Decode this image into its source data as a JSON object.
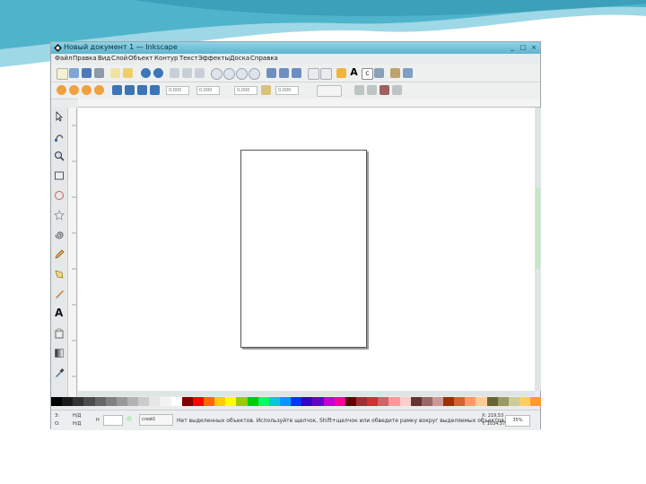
{
  "window": {
    "title": "Новый документ 1 — Inkscape"
  },
  "menubar": {
    "items": [
      "Файл",
      "Правка",
      "Вид",
      "Слой",
      "Объект",
      "Контур",
      "Текст",
      "Эффекты",
      "Доска",
      "Справка"
    ]
  },
  "toolcontrols": {
    "fields": [
      "0,000",
      "0,000",
      "0,000",
      "0,000"
    ]
  },
  "toolbox": {
    "tools": [
      "selector-icon",
      "node-icon",
      "zoom-icon",
      "rectangle-icon",
      "ellipse-icon",
      "star-icon",
      "spiral-icon",
      "pencil-icon",
      "pen-icon",
      "calligraphy-icon",
      "text-icon",
      "spray-icon",
      "gradient-icon",
      "dropper-icon"
    ]
  },
  "statusbar": {
    "fill_label": "З:",
    "stroke_label": "О:",
    "fill_value": "Н/Д",
    "stroke_value": "Н/Д",
    "opacity_label": "Н",
    "layer": "слой1",
    "message": "Нет выделенных объектов. Используйте щелчок, Shift+щелчок или обведите рамку вокруг выделяемых объектов",
    "coords_x": "X: 219,53",
    "coords_y": "Y: 1034,57",
    "zoom": "35%"
  },
  "colors": {
    "title_gradient_top": "#8fd3e6",
    "title_gradient_bottom": "#5fb4cf",
    "wave_teal": "#4fb3cc",
    "canvas": "#ffffff"
  },
  "palette": [
    "#000000",
    "#1a1a1a",
    "#333333",
    "#4d4d4d",
    "#666666",
    "#808080",
    "#999999",
    "#b3b3b3",
    "#cccccc",
    "#e6e6e6",
    "#f2f2f2",
    "#ffffff",
    "#800000",
    "#ff0000",
    "#ff6600",
    "#ffcc00",
    "#ffff00",
    "#99cc00",
    "#00cc00",
    "#00ff66",
    "#00cccc",
    "#0099ff",
    "#0033ff",
    "#3300cc",
    "#6600cc",
    "#cc00cc",
    "#ff0099",
    "#660000",
    "#993333",
    "#cc3333",
    "#cc6666",
    "#ff9999",
    "#ffcccc",
    "#663333",
    "#996666",
    "#cc9999",
    "#993300",
    "#cc6633",
    "#ff9966",
    "#ffcc99",
    "#666633",
    "#999966",
    "#cccc99",
    "#ffcc66",
    "#ff9933"
  ]
}
